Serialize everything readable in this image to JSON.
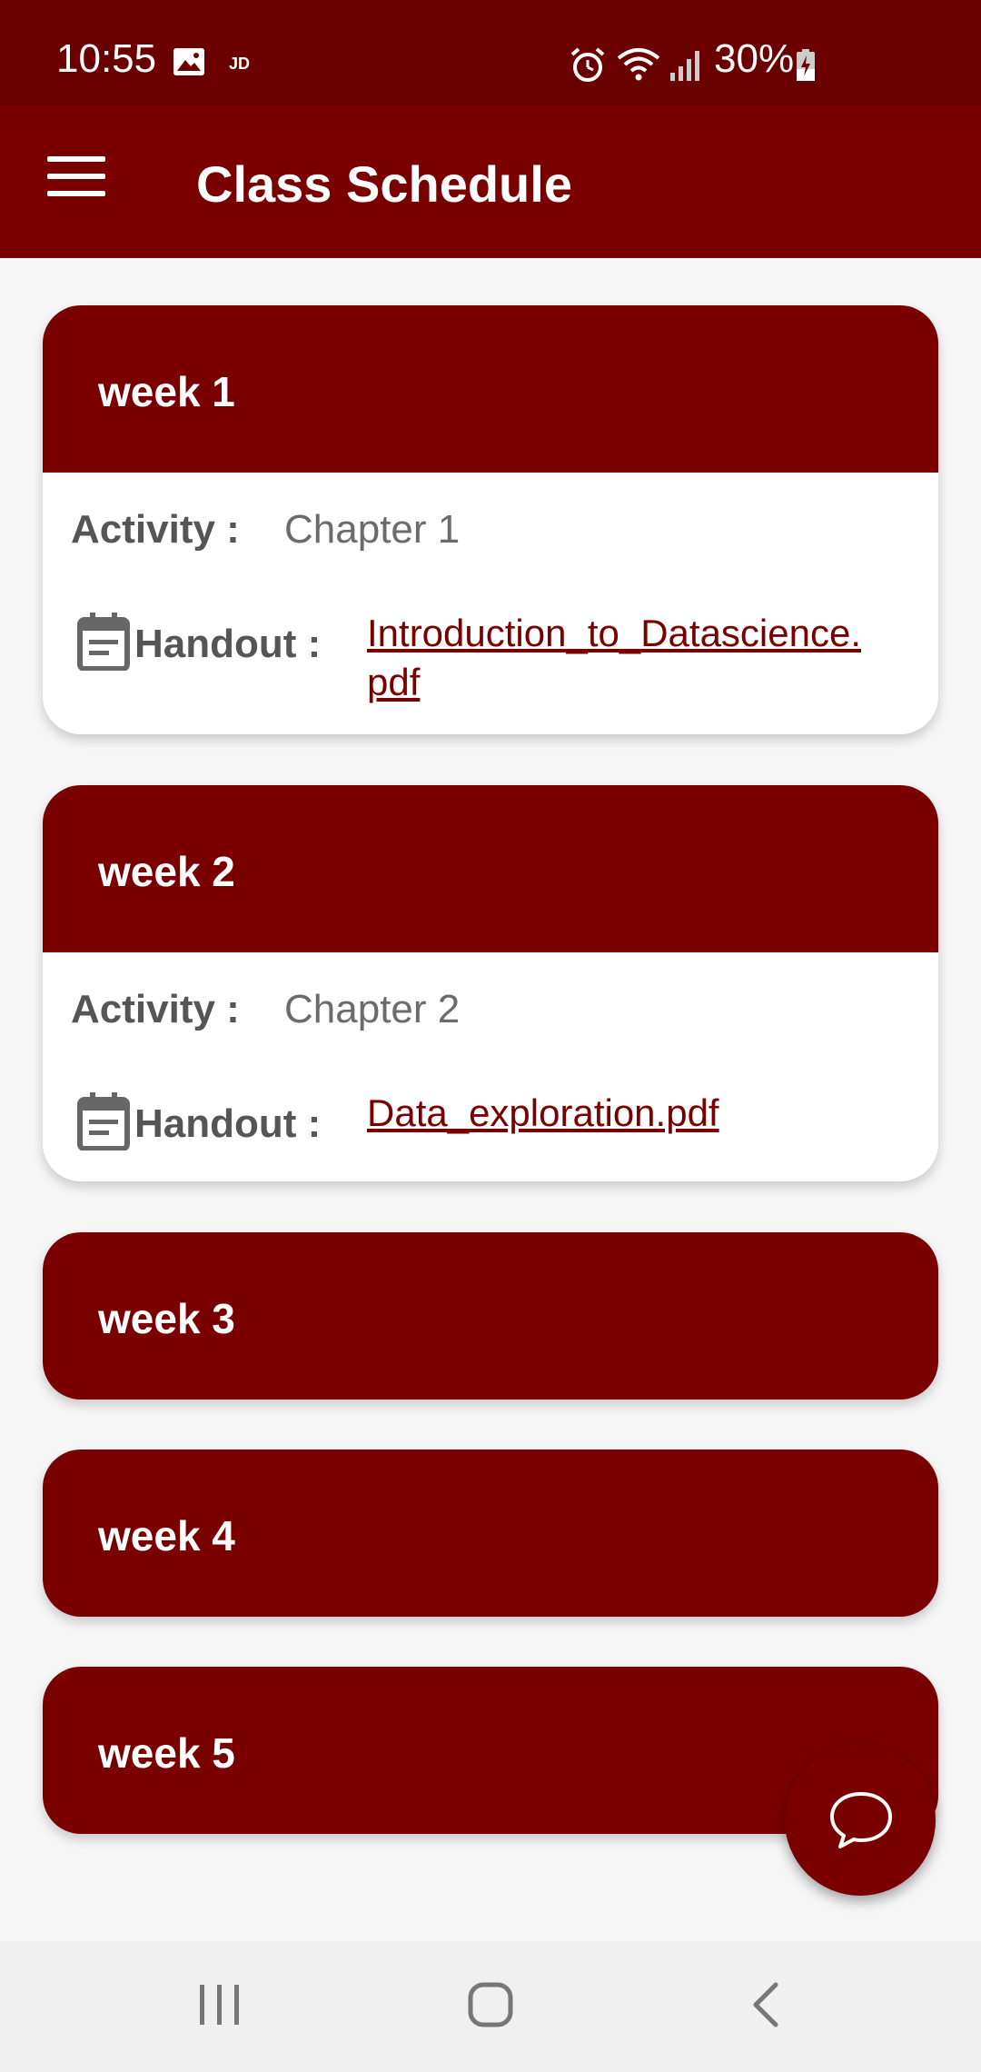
{
  "status_bar": {
    "time": "10:55",
    "carrier_badge": "JD",
    "battery": "30%",
    "icons": [
      "image-icon",
      "alarm-icon",
      "wifi-icon",
      "signal-icon",
      "battery-charging-icon"
    ]
  },
  "app_bar": {
    "title": "Class Schedule",
    "menu_icon": "hamburger-menu-icon"
  },
  "weeks": [
    {
      "label": "week 1",
      "expanded": true,
      "activity_label": "Activity :",
      "activity_value": "Chapter 1",
      "handout_label": "Handout :",
      "handout_line1": "Introduction_to_Datascience.",
      "handout_line2": "pdf"
    },
    {
      "label": "week 2",
      "expanded": true,
      "activity_label": "Activity :",
      "activity_value": "Chapter 2",
      "handout_label": "Handout :",
      "handout_line1": "Data_exploration.pdf"
    },
    {
      "label": "week 3",
      "expanded": false
    },
    {
      "label": "week 4",
      "expanded": false
    },
    {
      "label": "week 5",
      "expanded": false
    }
  ],
  "fab": {
    "icon": "chat-bubble-icon"
  },
  "nav_bar": {
    "buttons": [
      "recent-apps-icon",
      "home-icon",
      "back-icon"
    ]
  },
  "colors": {
    "primary": "#7a0000",
    "status_bar": "#6b0000",
    "background": "#f6f6f6"
  }
}
